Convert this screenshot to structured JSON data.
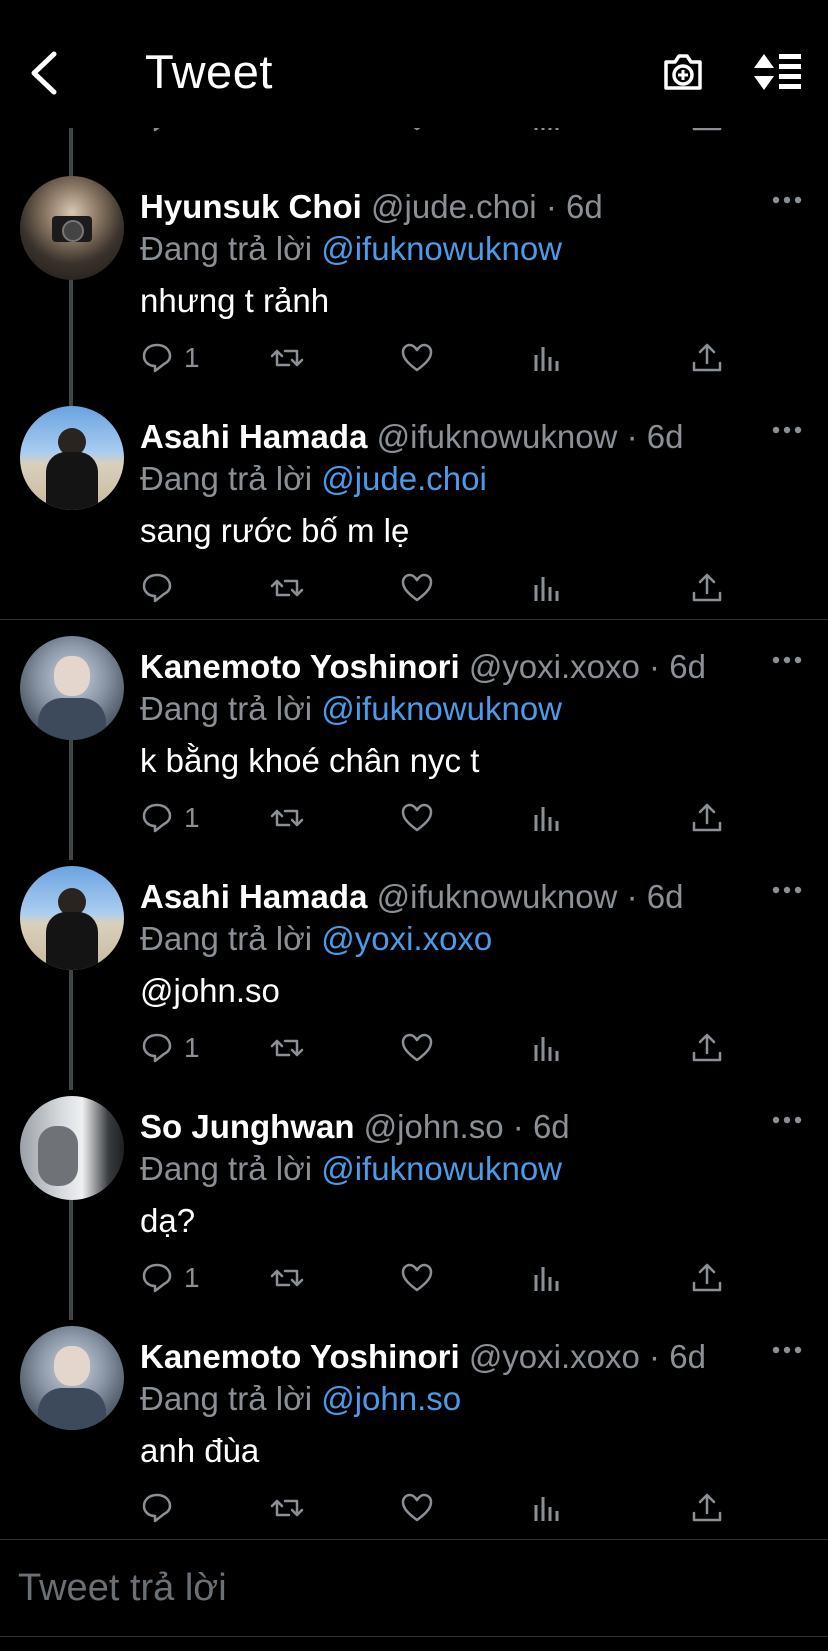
{
  "header": {
    "title": "Tweet",
    "back_icon": "chevron-left-icon",
    "camera_icon": "camera-plus-icon",
    "sort_icon": "sort-replies-icon"
  },
  "colors": {
    "background": "#000000",
    "mention": "#4c9be8",
    "muted": "#8b9096",
    "thread_line": "#3f4448"
  },
  "reply_prefix": "Đang trả lời",
  "tweets": [
    {
      "name": "Hyunsuk Choi",
      "handle": "@jude.choi",
      "time": "6d",
      "reply_to": "@ifuknowuknow",
      "text": "nhưng t rảnh",
      "text_is_mention": false,
      "reply_count": "1"
    },
    {
      "name": "Asahi Hamada",
      "handle": "@ifuknowuknow",
      "time": "6d",
      "reply_to": "@jude.choi",
      "text": "sang rước bố m lẹ",
      "text_is_mention": false,
      "reply_count": ""
    },
    {
      "name": "Kanemoto Yoshinori",
      "handle": "@yoxi.xoxo",
      "time": "6d",
      "reply_to": "@ifuknowuknow",
      "text": "k bằng khoé chân nyc t",
      "text_is_mention": false,
      "reply_count": "1"
    },
    {
      "name": "Asahi Hamada",
      "handle": "@ifuknowuknow",
      "time": "6d",
      "reply_to": "@yoxi.xoxo",
      "text": "@john.so",
      "text_is_mention": true,
      "reply_count": "1"
    },
    {
      "name": "So Junghwan",
      "handle": "@john.so",
      "time": "6d",
      "reply_to": "@ifuknowuknow",
      "text": "dạ?",
      "text_is_mention": false,
      "reply_count": "1"
    },
    {
      "name": "Kanemoto Yoshinori",
      "handle": "@yoxi.xoxo",
      "time": "6d",
      "reply_to": "@john.so",
      "text": "anh đùa",
      "text_is_mention": false,
      "reply_count": ""
    }
  ],
  "reply_bar": {
    "placeholder": "Tweet trả lời"
  }
}
